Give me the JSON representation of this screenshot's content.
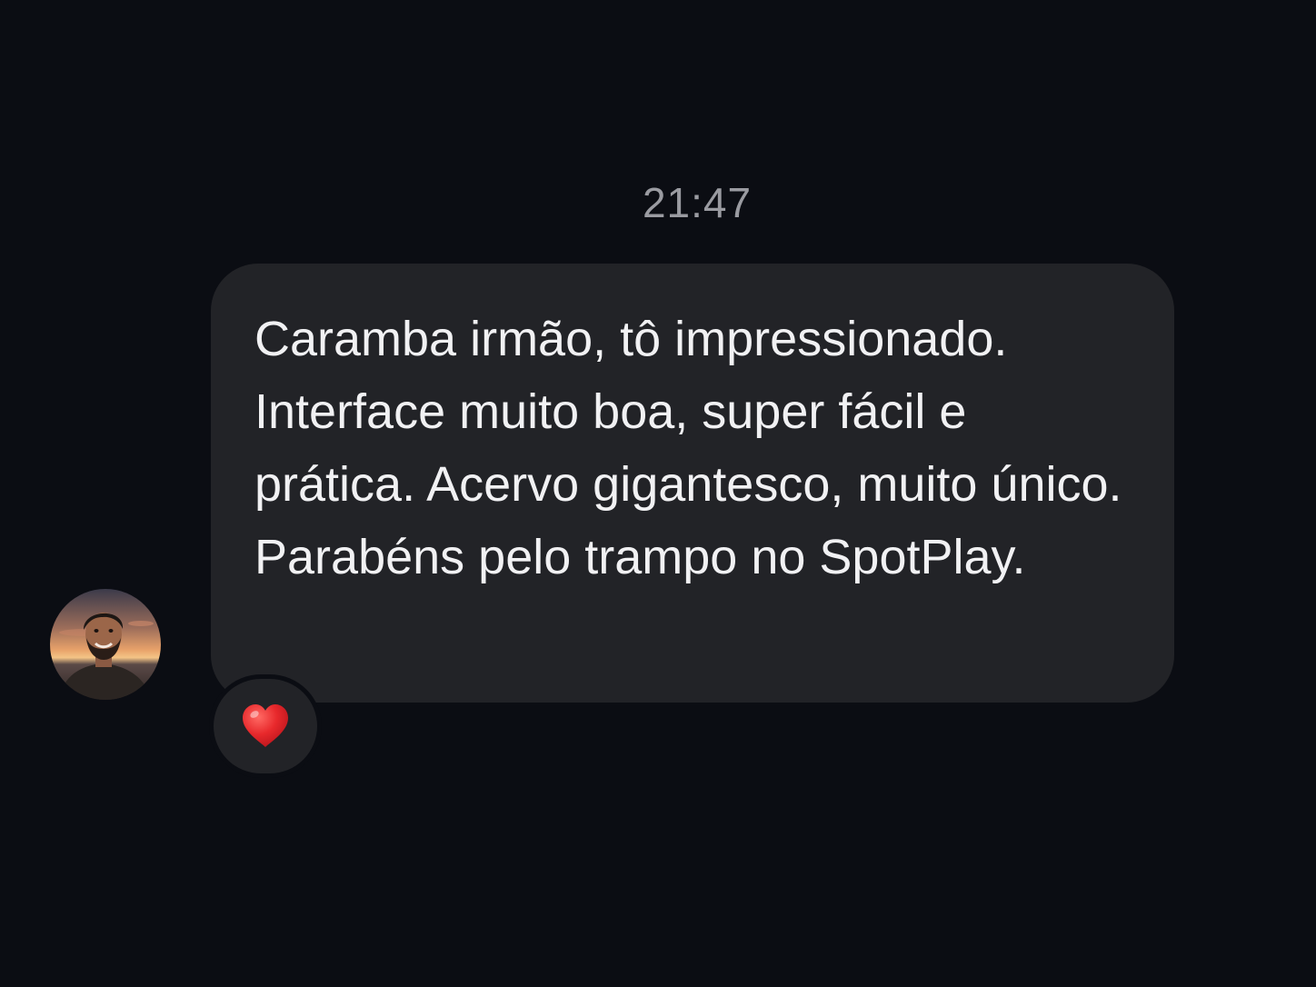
{
  "chat": {
    "timestamp": "21:47",
    "message": {
      "text": "Caramba irmão, tô impressionado. Interface muito boa, super fácil e prática. Acervo gigantesco, muito único. Parabéns pelo trampo no SpotPlay.",
      "reaction": "heart-icon",
      "reaction_color": "#e3262c"
    },
    "avatar": "avatar-photo"
  },
  "colors": {
    "background": "#0b0d13",
    "bubble": "#222327",
    "text": "#f1f1f3",
    "timestamp": "#9a9ba1"
  }
}
